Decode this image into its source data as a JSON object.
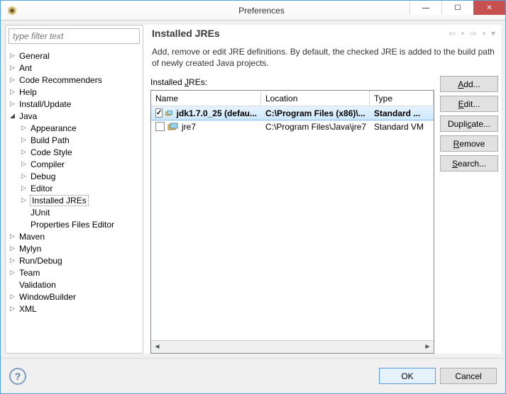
{
  "window": {
    "title": "Preferences"
  },
  "sidebar": {
    "filter_placeholder": "type filter text",
    "items": [
      {
        "label": "General",
        "depth": 0,
        "expandable": true
      },
      {
        "label": "Ant",
        "depth": 0,
        "expandable": true
      },
      {
        "label": "Code Recommenders",
        "depth": 0,
        "expandable": true
      },
      {
        "label": "Help",
        "depth": 0,
        "expandable": true
      },
      {
        "label": "Install/Update",
        "depth": 0,
        "expandable": true
      },
      {
        "label": "Java",
        "depth": 0,
        "expandable": true,
        "expanded": true
      },
      {
        "label": "Appearance",
        "depth": 1,
        "expandable": true
      },
      {
        "label": "Build Path",
        "depth": 1,
        "expandable": true
      },
      {
        "label": "Code Style",
        "depth": 1,
        "expandable": true
      },
      {
        "label": "Compiler",
        "depth": 1,
        "expandable": true
      },
      {
        "label": "Debug",
        "depth": 1,
        "expandable": true
      },
      {
        "label": "Editor",
        "depth": 1,
        "expandable": true
      },
      {
        "label": "Installed JREs",
        "depth": 1,
        "expandable": true,
        "selected": true
      },
      {
        "label": "JUnit",
        "depth": 1,
        "expandable": false
      },
      {
        "label": "Properties Files Editor",
        "depth": 1,
        "expandable": false
      },
      {
        "label": "Maven",
        "depth": 0,
        "expandable": true
      },
      {
        "label": "Mylyn",
        "depth": 0,
        "expandable": true
      },
      {
        "label": "Run/Debug",
        "depth": 0,
        "expandable": true
      },
      {
        "label": "Team",
        "depth": 0,
        "expandable": true
      },
      {
        "label": "Validation",
        "depth": 0,
        "expandable": false
      },
      {
        "label": "WindowBuilder",
        "depth": 0,
        "expandable": true
      },
      {
        "label": "XML",
        "depth": 0,
        "expandable": true
      }
    ]
  },
  "page": {
    "title": "Installed JREs",
    "description": "Add, remove or edit JRE definitions. By default, the checked JRE is added to the build path of newly created Java projects.",
    "table_label": "Installed JREs:",
    "columns": {
      "name": "Name",
      "location": "Location",
      "type": "Type"
    },
    "rows": [
      {
        "checked": true,
        "selected": true,
        "name": "jdk1.7.0_25 (defau...",
        "location": "C:\\Program Files (x86)\\...",
        "type": "Standard ..."
      },
      {
        "checked": false,
        "selected": false,
        "name": "jre7",
        "location": "C:\\Program Files\\Java\\jre7",
        "type": "Standard VM"
      }
    ],
    "buttons": {
      "add": "Add...",
      "edit": "Edit...",
      "duplicate": "Duplicate...",
      "remove": "Remove",
      "search": "Search..."
    }
  },
  "footer": {
    "ok": "OK",
    "cancel": "Cancel"
  }
}
